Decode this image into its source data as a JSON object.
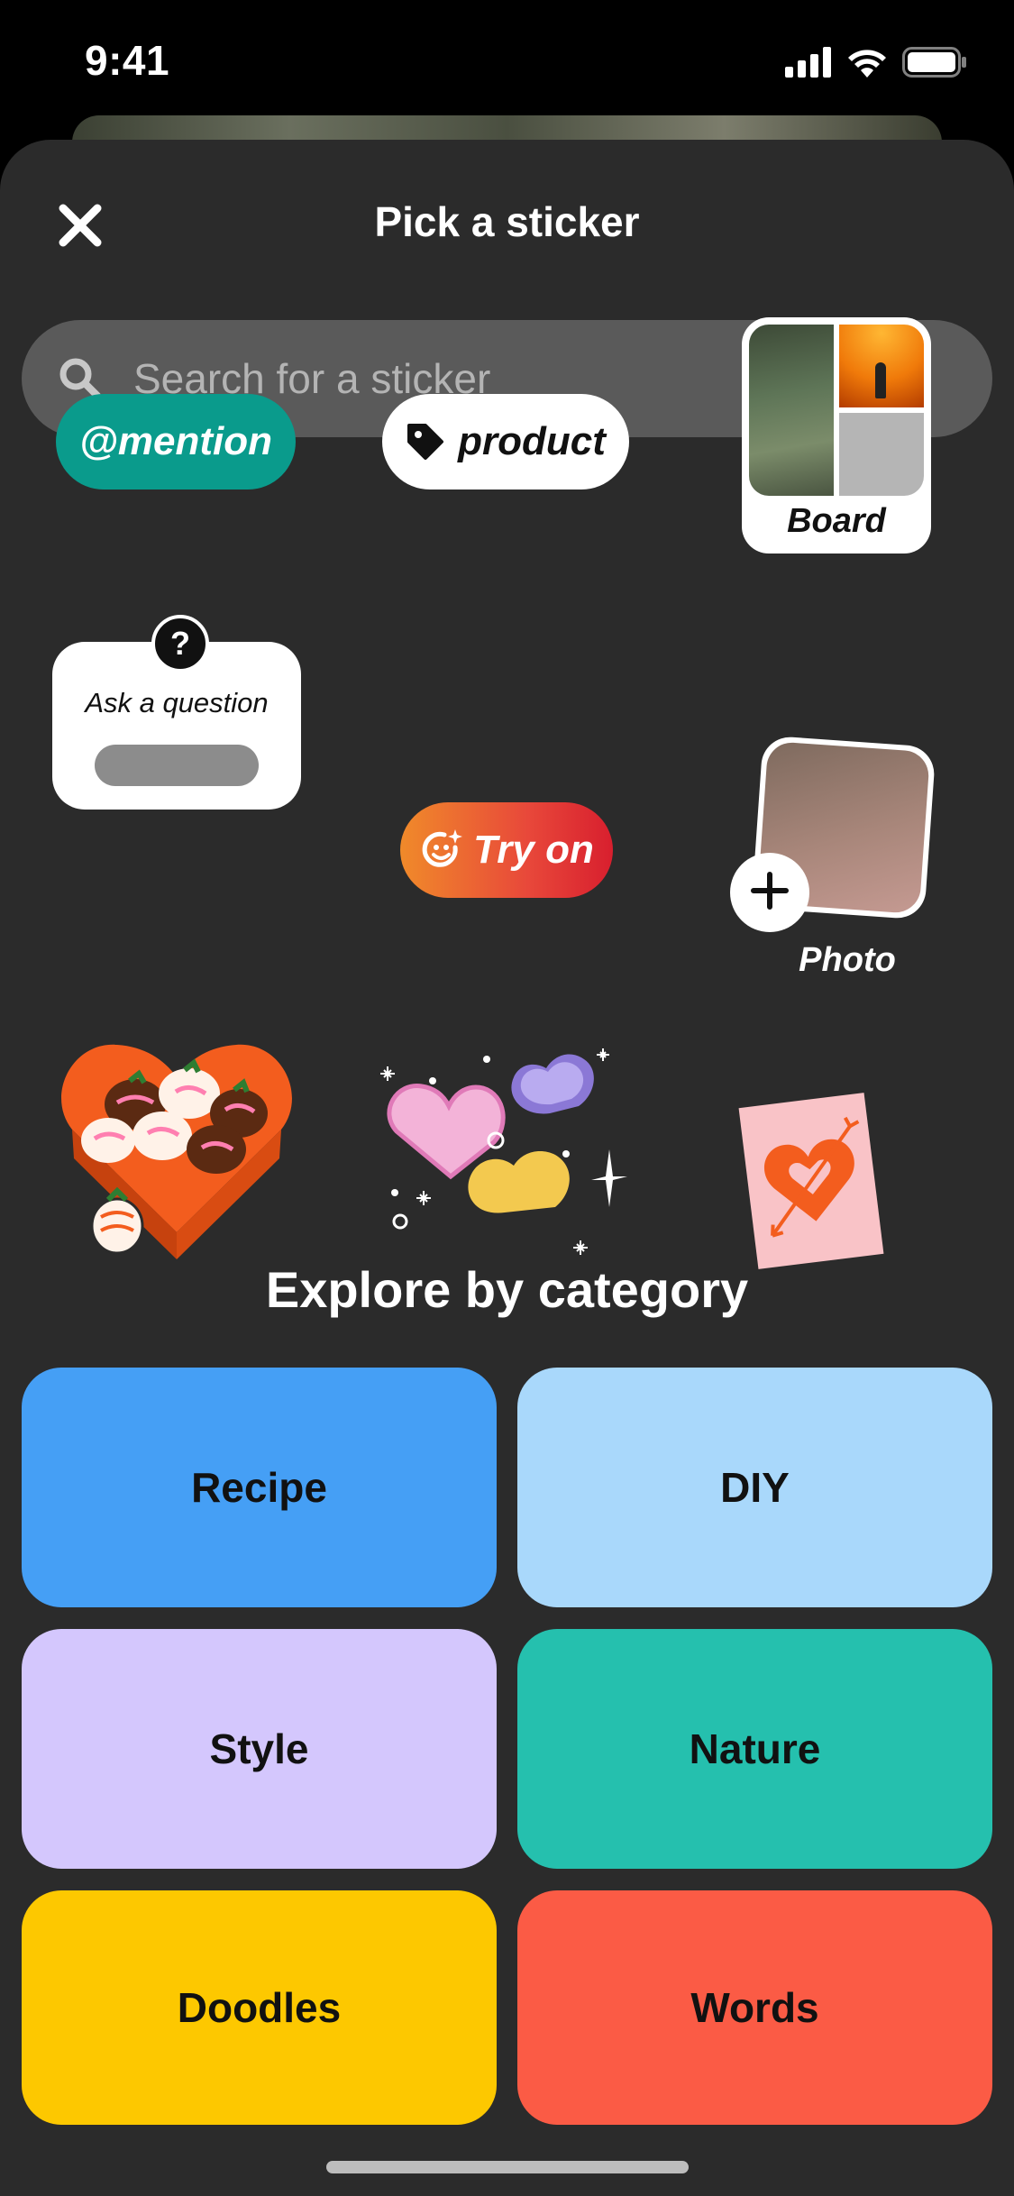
{
  "status_bar": {
    "time": "9:41"
  },
  "sheet": {
    "title": "Pick a sticker"
  },
  "search": {
    "placeholder": "Search for a sticker"
  },
  "stickers": {
    "mention": "@mention",
    "product": "product",
    "board": "Board",
    "ask_question": "Ask a question",
    "ask_badge": "?",
    "try_on": "Try on",
    "photo": "Photo"
  },
  "explore": {
    "title": "Explore by category",
    "categories": [
      "Recipe",
      "DIY",
      "Style",
      "Nature",
      "Doodles",
      "Words"
    ]
  },
  "colors": {
    "sheet_bg": "#2b2b2b",
    "mention_bg": "#0a9b8c",
    "recipe": "#459ff5",
    "diy": "#a9d8fb",
    "style": "#d4c7fd",
    "nature": "#25c0ae",
    "doodles": "#fdc800",
    "words": "#fb5b45"
  },
  "icons": {
    "close": "close-icon",
    "search": "search-icon",
    "tag": "tag-icon",
    "face": "face-sparkle-icon",
    "add": "plus-icon",
    "cellular": "cellular-signal-icon",
    "wifi": "wifi-icon",
    "battery": "battery-icon"
  }
}
